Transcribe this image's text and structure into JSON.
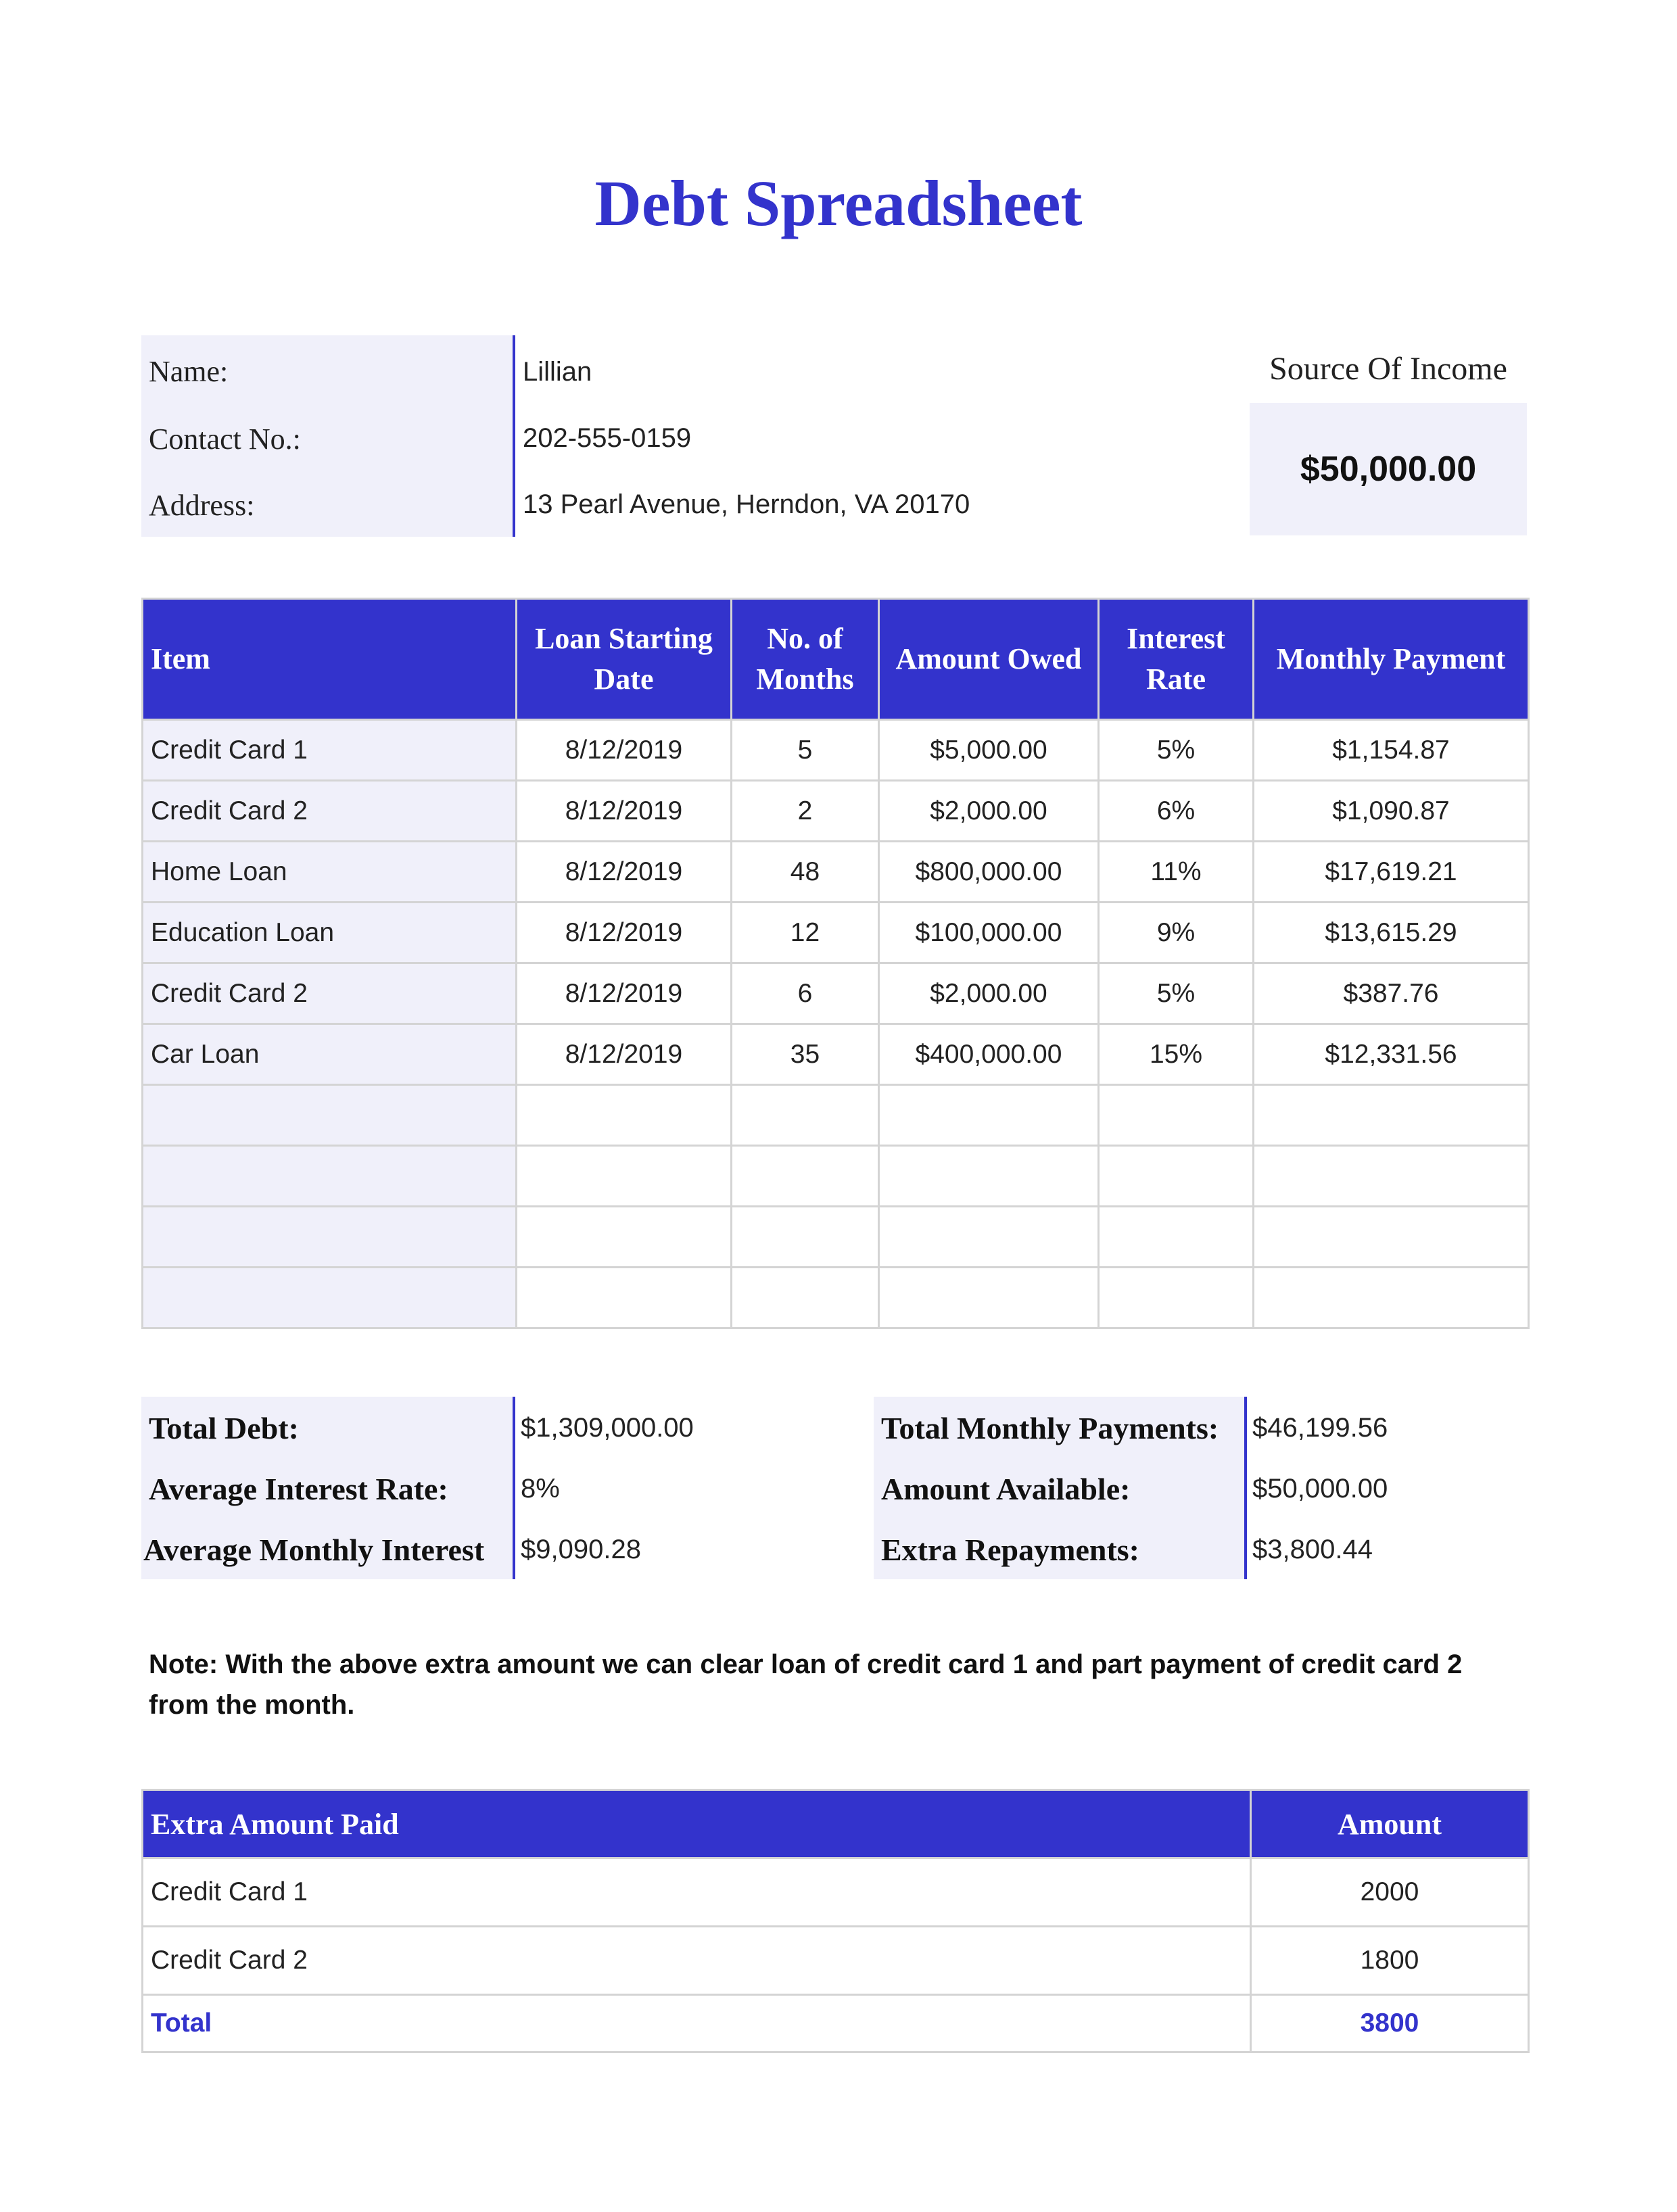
{
  "title": "Debt Spreadsheet",
  "info": {
    "name_label": "Name:",
    "name_value": "Lillian",
    "contact_label": "Contact No.:",
    "contact_value": "202-555-0159",
    "address_label": "Address:",
    "address_value": "13 Pearl Avenue, Herndon, VA 20170"
  },
  "income": {
    "title": "Source Of Income",
    "value": "$50,000.00"
  },
  "debt_table": {
    "headers": [
      "Item",
      "Loan Starting Date",
      "No. of Months",
      "Amount Owed",
      "Interest Rate",
      "Monthly Payment"
    ],
    "rows": [
      [
        "Credit Card 1",
        "8/12/2019",
        "5",
        "$5,000.00",
        "5%",
        "$1,154.87"
      ],
      [
        "Credit Card 2",
        "8/12/2019",
        "2",
        "$2,000.00",
        "6%",
        "$1,090.87"
      ],
      [
        "Home Loan",
        "8/12/2019",
        "48",
        "$800,000.00",
        "11%",
        "$17,619.21"
      ],
      [
        "Education Loan",
        "8/12/2019",
        "12",
        "$100,000.00",
        "9%",
        "$13,615.29"
      ],
      [
        "Credit Card 2",
        "8/12/2019",
        "6",
        "$2,000.00",
        "5%",
        "$387.76"
      ],
      [
        "Car Loan",
        "8/12/2019",
        "35",
        "$400,000.00",
        "15%",
        "$12,331.56"
      ],
      [
        "",
        "",
        "",
        "",
        "",
        ""
      ],
      [
        "",
        "",
        "",
        "",
        "",
        ""
      ],
      [
        "",
        "",
        "",
        "",
        "",
        ""
      ],
      [
        "",
        "",
        "",
        "",
        "",
        ""
      ]
    ]
  },
  "summary_left": {
    "total_debt_label": "Total Debt:",
    "total_debt_value": "$1,309,000.00",
    "avg_rate_label": "Average Interest Rate:",
    "avg_rate_value": "8%",
    "avg_interest_label": "Average Monthly Interest",
    "avg_interest_value": "$9,090.28"
  },
  "summary_right": {
    "total_payments_label": "Total Monthly Payments:",
    "total_payments_value": "$46,199.56",
    "available_label": "Amount Available:",
    "available_value": "$50,000.00",
    "extra_label": "Extra Repayments:",
    "extra_value": "$3,800.44"
  },
  "note": "Note: With the above extra amount we can clear loan of credit card 1 and part payment of credit card 2 from the month.",
  "extra_table": {
    "header_item": "Extra Amount Paid",
    "header_amount": "Amount",
    "rows": [
      [
        "Credit Card 1",
        "2000"
      ],
      [
        "Credit Card 2",
        "1800"
      ]
    ],
    "total_label": "Total",
    "total_value": "3800"
  },
  "colors": {
    "accent": "#3333cc",
    "label_background": "#f0f0fa"
  }
}
